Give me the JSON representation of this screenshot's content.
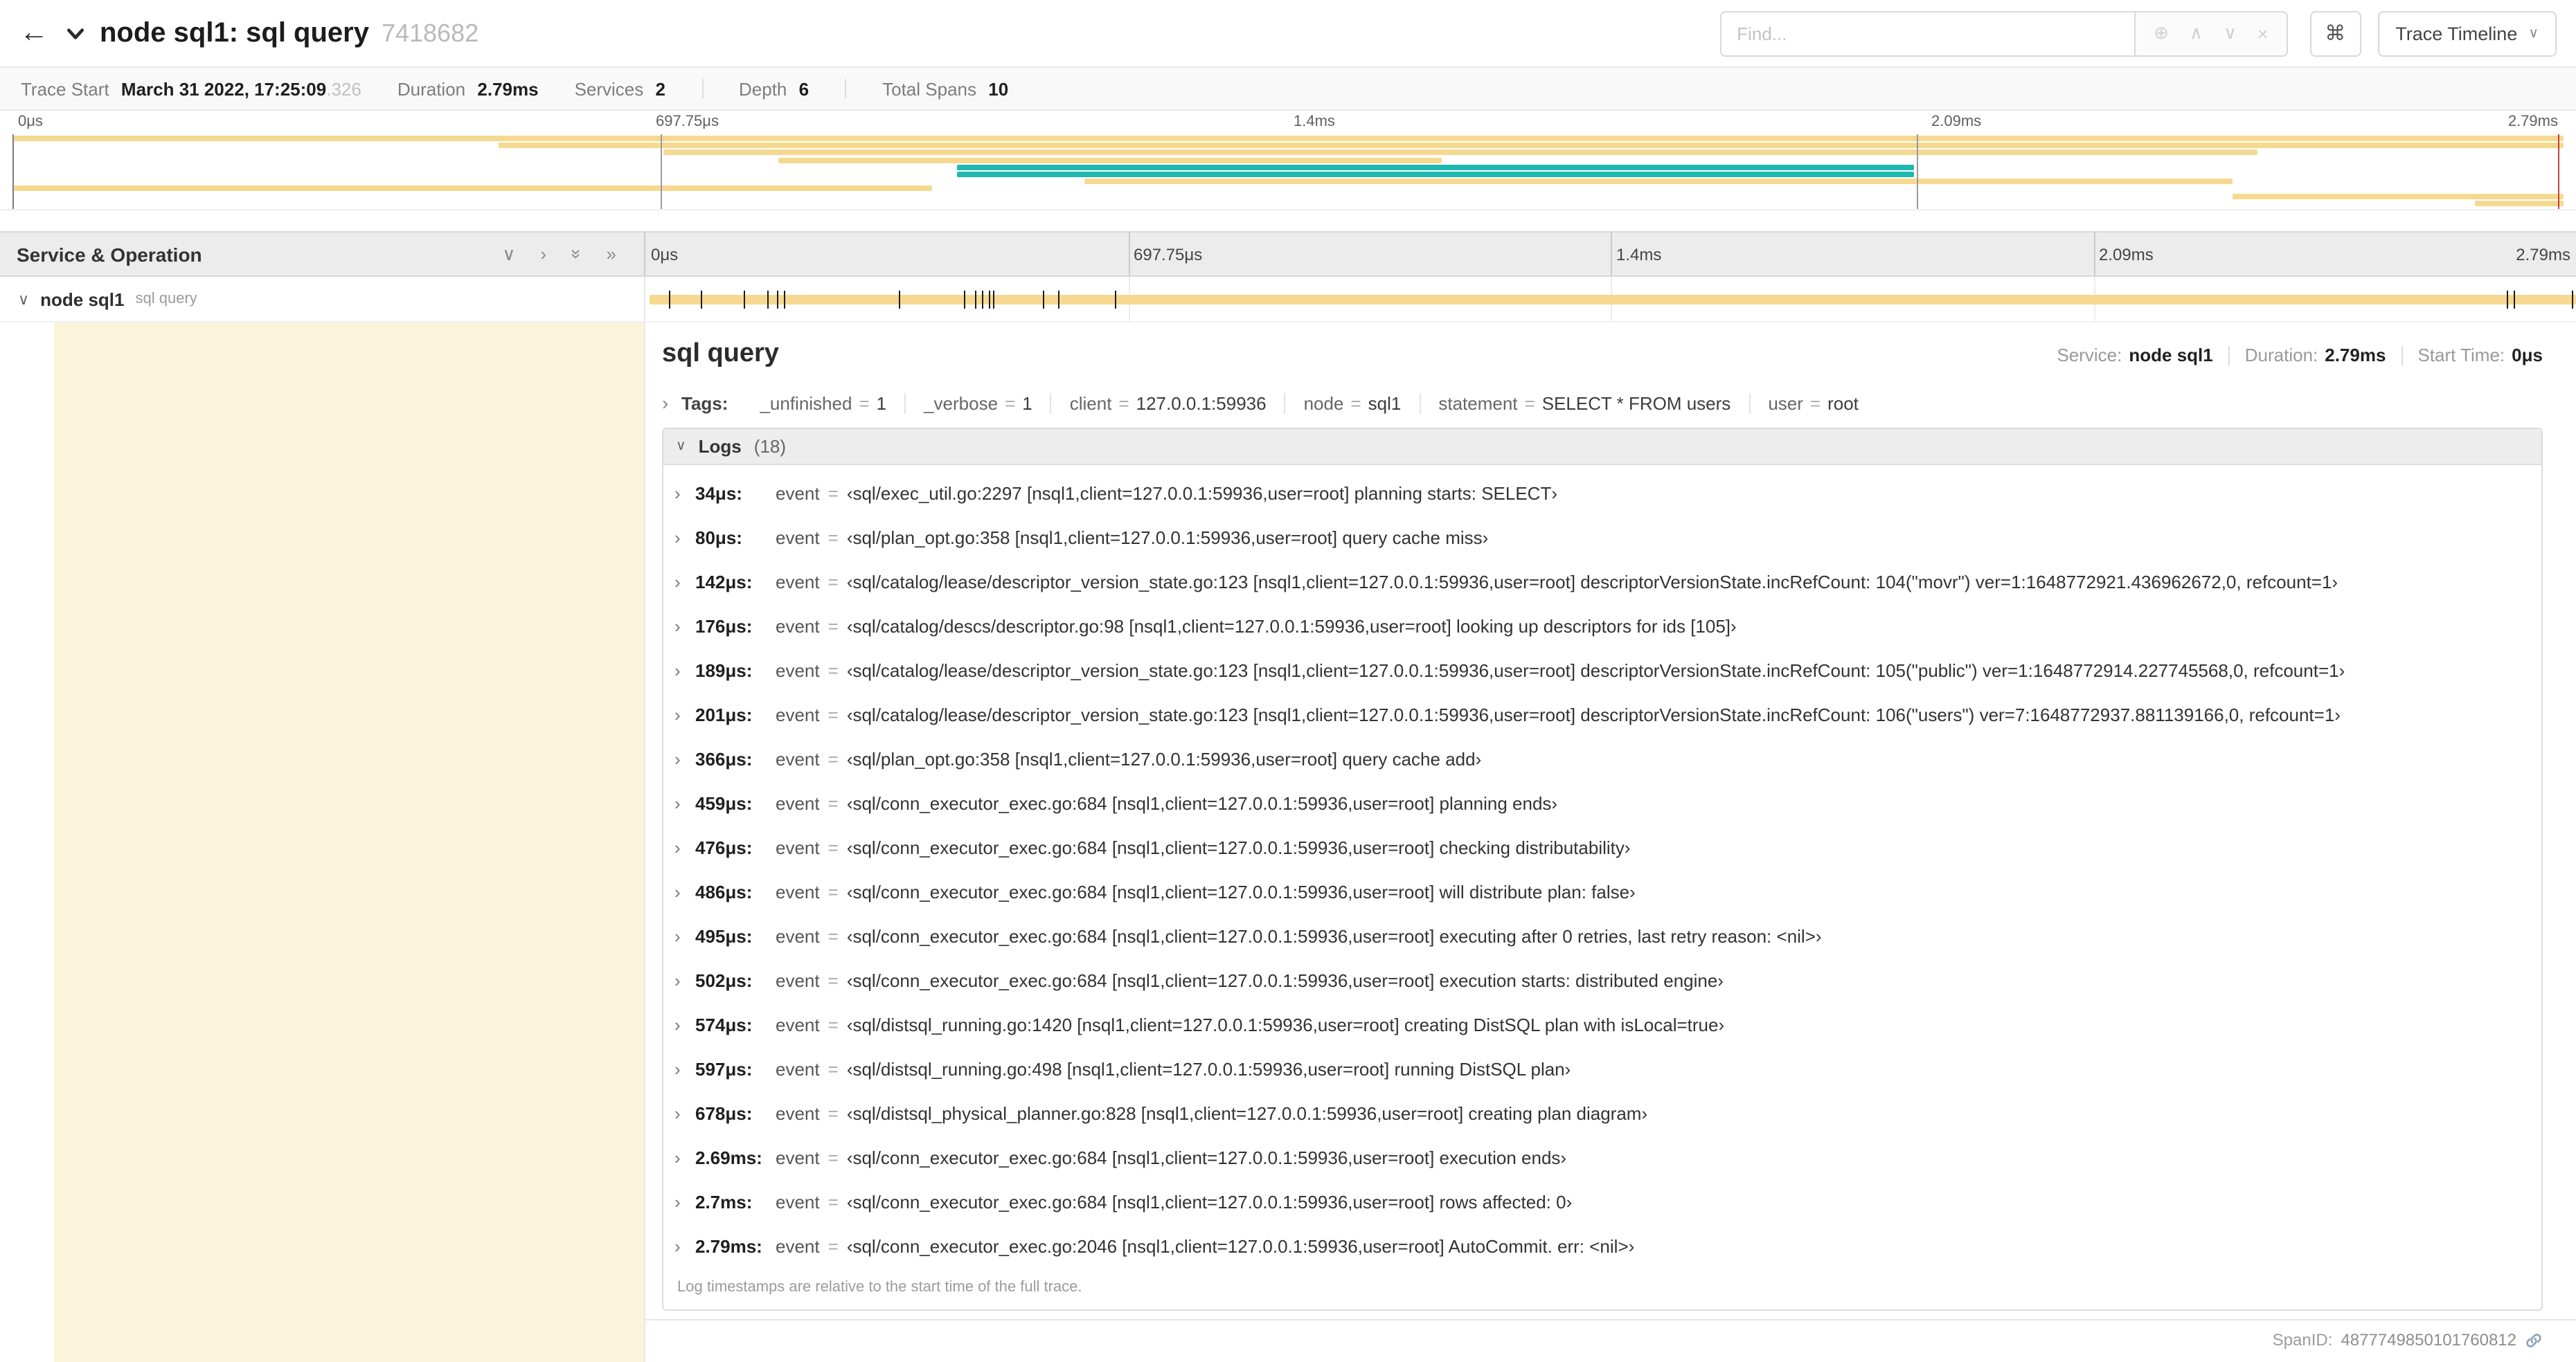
{
  "colors": {
    "span_tan": "#f5d990",
    "span_teal": "#1fb8b0",
    "selected_row_tint": "rgba(245,217,144,0.32)",
    "cursor_red": "#c0453e"
  },
  "icons": {
    "back": "←",
    "chevron_down": "∨",
    "chevron_right": "›",
    "double_chevron": "»",
    "focus": "⊕",
    "prev": "∧",
    "next": "∨",
    "clear": "×",
    "command": "⌘"
  },
  "header": {
    "title": "node sql1: sql query",
    "trace_id": "7418682",
    "find_placeholder": "Find...",
    "view_selector": "Trace Timeline"
  },
  "summary": {
    "trace_start_label": "Trace Start",
    "trace_start_value": "March 31 2022, 17:25:09",
    "trace_start_frac": ".326",
    "duration_label": "Duration",
    "duration_value": "2.79ms",
    "services_label": "Services",
    "services_value": "2",
    "depth_label": "Depth",
    "depth_value": "6",
    "total_spans_label": "Total Spans",
    "total_spans_value": "10"
  },
  "timeline": {
    "ticks": [
      "0μs",
      "697.75μs",
      "1.4ms",
      "2.09ms",
      "2.79ms"
    ],
    "header_left": "Service & Operation",
    "minimap": {
      "spans": [
        {
          "start": 0,
          "end": 100,
          "color": "span_tan"
        },
        {
          "start": 19,
          "end": 100,
          "color": "span_tan"
        },
        {
          "start": 25.5,
          "end": 88,
          "color": "span_tan"
        },
        {
          "start": 30,
          "end": 56,
          "color": "span_tan"
        },
        {
          "start": 37,
          "end": 74.5,
          "color": "span_teal"
        },
        {
          "start": 37,
          "end": 74.5,
          "color": "span_teal"
        },
        {
          "start": 42,
          "end": 87,
          "color": "span_tan"
        },
        {
          "start": 0,
          "end": 36,
          "color": "span_tan"
        },
        {
          "start": 87,
          "end": 100,
          "color": "span_tan"
        },
        {
          "start": 96.5,
          "end": 100,
          "color": "span_tan"
        }
      ],
      "scrubbers": [
        25.35,
        74.65
      ],
      "cursor": 99.8
    },
    "row": {
      "service": "node sql1",
      "operation": "sql query",
      "log_ticks_pct": [
        1.2,
        2.9,
        5.1,
        6.3,
        6.8,
        7.2,
        13.1,
        16.5,
        17.1,
        17.4,
        17.8,
        18.0,
        20.6,
        21.4,
        24.3,
        96.4,
        96.8,
        99.8
      ]
    }
  },
  "detail": {
    "title": "sql query",
    "service_label": "Service:",
    "service_value": "node sql1",
    "duration_label": "Duration:",
    "duration_value": "2.79ms",
    "start_label": "Start Time:",
    "start_value": "0μs",
    "tags_label": "Tags:",
    "eq": "=",
    "tags": [
      {
        "key": "_unfinished",
        "value": "1"
      },
      {
        "key": "_verbose",
        "value": "1"
      },
      {
        "key": "client",
        "value": "127.0.0.1:59936"
      },
      {
        "key": "node",
        "value": "sql1"
      },
      {
        "key": "statement",
        "value": "SELECT * FROM users"
      },
      {
        "key": "user",
        "value": "root"
      }
    ],
    "logs_label": "Logs",
    "logs_count": "(18)",
    "logs": [
      {
        "time": "34μs:",
        "field": "event",
        "value": "‹sql/exec_util.go:2297 [nsql1,client=127.0.0.1:59936,user=root] planning starts: SELECT›"
      },
      {
        "time": "80μs:",
        "field": "event",
        "value": "‹sql/plan_opt.go:358 [nsql1,client=127.0.0.1:59936,user=root] query cache miss›"
      },
      {
        "time": "142μs:",
        "field": "event",
        "value": "‹sql/catalog/lease/descriptor_version_state.go:123 [nsql1,client=127.0.0.1:59936,user=root] descriptorVersionState.incRefCount: 104(\"movr\") ver=1:1648772921.436962672,0, refcount=1›"
      },
      {
        "time": "176μs:",
        "field": "event",
        "value": "‹sql/catalog/descs/descriptor.go:98 [nsql1,client=127.0.0.1:59936,user=root] looking up descriptors for ids [105]›"
      },
      {
        "time": "189μs:",
        "field": "event",
        "value": "‹sql/catalog/lease/descriptor_version_state.go:123 [nsql1,client=127.0.0.1:59936,user=root] descriptorVersionState.incRefCount: 105(\"public\") ver=1:1648772914.227745568,0, refcount=1›"
      },
      {
        "time": "201μs:",
        "field": "event",
        "value": "‹sql/catalog/lease/descriptor_version_state.go:123 [nsql1,client=127.0.0.1:59936,user=root] descriptorVersionState.incRefCount: 106(\"users\") ver=7:1648772937.881139166,0, refcount=1›"
      },
      {
        "time": "366μs:",
        "field": "event",
        "value": "‹sql/plan_opt.go:358 [nsql1,client=127.0.0.1:59936,user=root] query cache add›"
      },
      {
        "time": "459μs:",
        "field": "event",
        "value": "‹sql/conn_executor_exec.go:684 [nsql1,client=127.0.0.1:59936,user=root] planning ends›"
      },
      {
        "time": "476μs:",
        "field": "event",
        "value": "‹sql/conn_executor_exec.go:684 [nsql1,client=127.0.0.1:59936,user=root] checking distributability›"
      },
      {
        "time": "486μs:",
        "field": "event",
        "value": "‹sql/conn_executor_exec.go:684 [nsql1,client=127.0.0.1:59936,user=root] will distribute plan: false›"
      },
      {
        "time": "495μs:",
        "field": "event",
        "value": "‹sql/conn_executor_exec.go:684 [nsql1,client=127.0.0.1:59936,user=root] executing after 0 retries, last retry reason: <nil>›"
      },
      {
        "time": "502μs:",
        "field": "event",
        "value": "‹sql/conn_executor_exec.go:684 [nsql1,client=127.0.0.1:59936,user=root] execution starts: distributed engine›"
      },
      {
        "time": "574μs:",
        "field": "event",
        "value": "‹sql/distsql_running.go:1420 [nsql1,client=127.0.0.1:59936,user=root] creating DistSQL plan with isLocal=true›"
      },
      {
        "time": "597μs:",
        "field": "event",
        "value": "‹sql/distsql_running.go:498 [nsql1,client=127.0.0.1:59936,user=root] running DistSQL plan›"
      },
      {
        "time": "678μs:",
        "field": "event",
        "value": "‹sql/distsql_physical_planner.go:828 [nsql1,client=127.0.0.1:59936,user=root] creating plan diagram›"
      },
      {
        "time": "2.69ms:",
        "field": "event",
        "value": "‹sql/conn_executor_exec.go:684 [nsql1,client=127.0.0.1:59936,user=root] execution ends›"
      },
      {
        "time": "2.7ms:",
        "field": "event",
        "value": "‹sql/conn_executor_exec.go:684 [nsql1,client=127.0.0.1:59936,user=root] rows affected: 0›"
      },
      {
        "time": "2.79ms:",
        "field": "event",
        "value": "‹sql/conn_executor_exec.go:2046 [nsql1,client=127.0.0.1:59936,user=root] AutoCommit. err: <nil>›"
      }
    ],
    "note": "Log timestamps are relative to the start time of the full trace.",
    "spanid_label": "SpanID:",
    "spanid_value": "4877749850101760812"
  }
}
